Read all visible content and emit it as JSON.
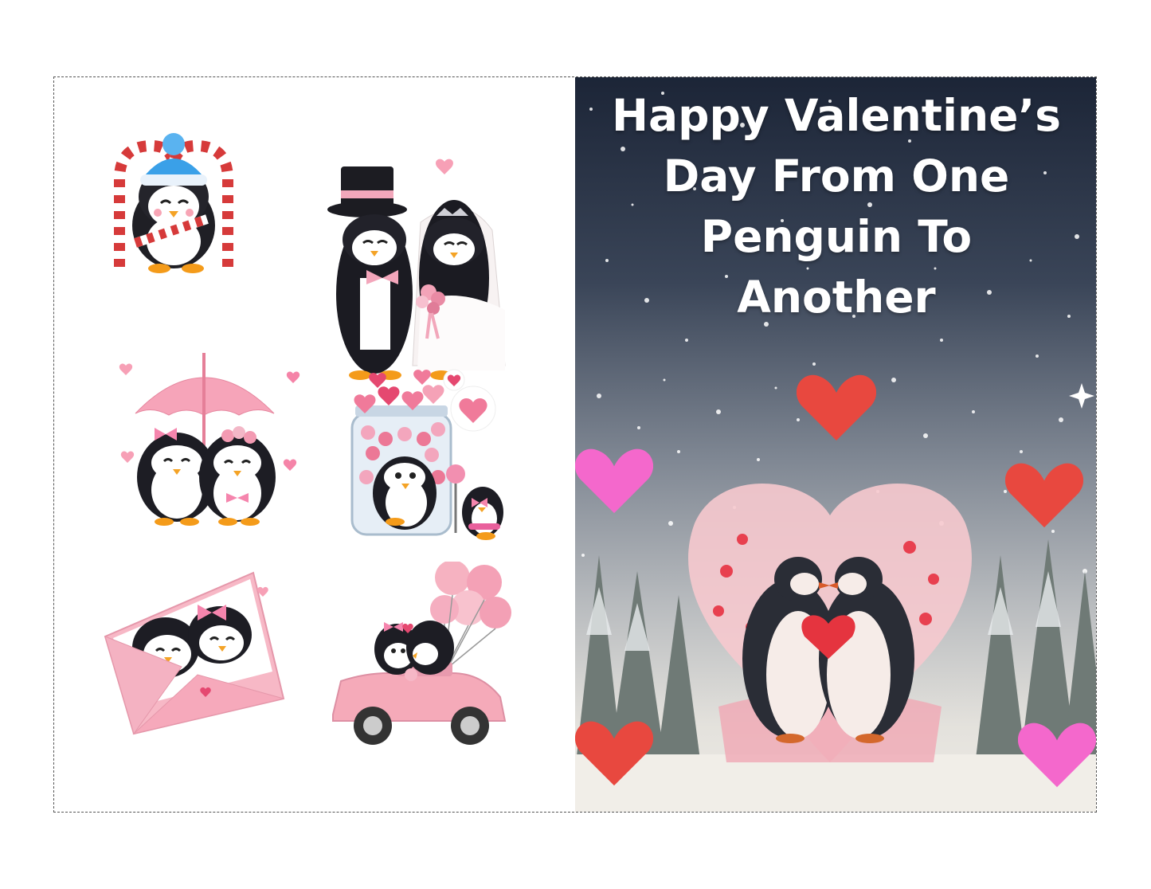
{
  "title_lines": [
    "Happy Valentine’s",
    "Day From One",
    "Penguin To",
    "Another"
  ],
  "colors": {
    "heart_red": "#e8483f",
    "heart_pink": "#f468cc",
    "sky_top": "#1c2537",
    "sky_bottom": "#efece6"
  },
  "stickers": [
    {
      "name": "candy-cane-penguin-sticker"
    },
    {
      "name": "wedding-penguins-sticker"
    },
    {
      "name": "umbrella-penguins-sticker"
    },
    {
      "name": "heart-jar-penguins-sticker"
    },
    {
      "name": "envelope-penguins-sticker"
    },
    {
      "name": "car-balloons-penguins-sticker"
    }
  ]
}
